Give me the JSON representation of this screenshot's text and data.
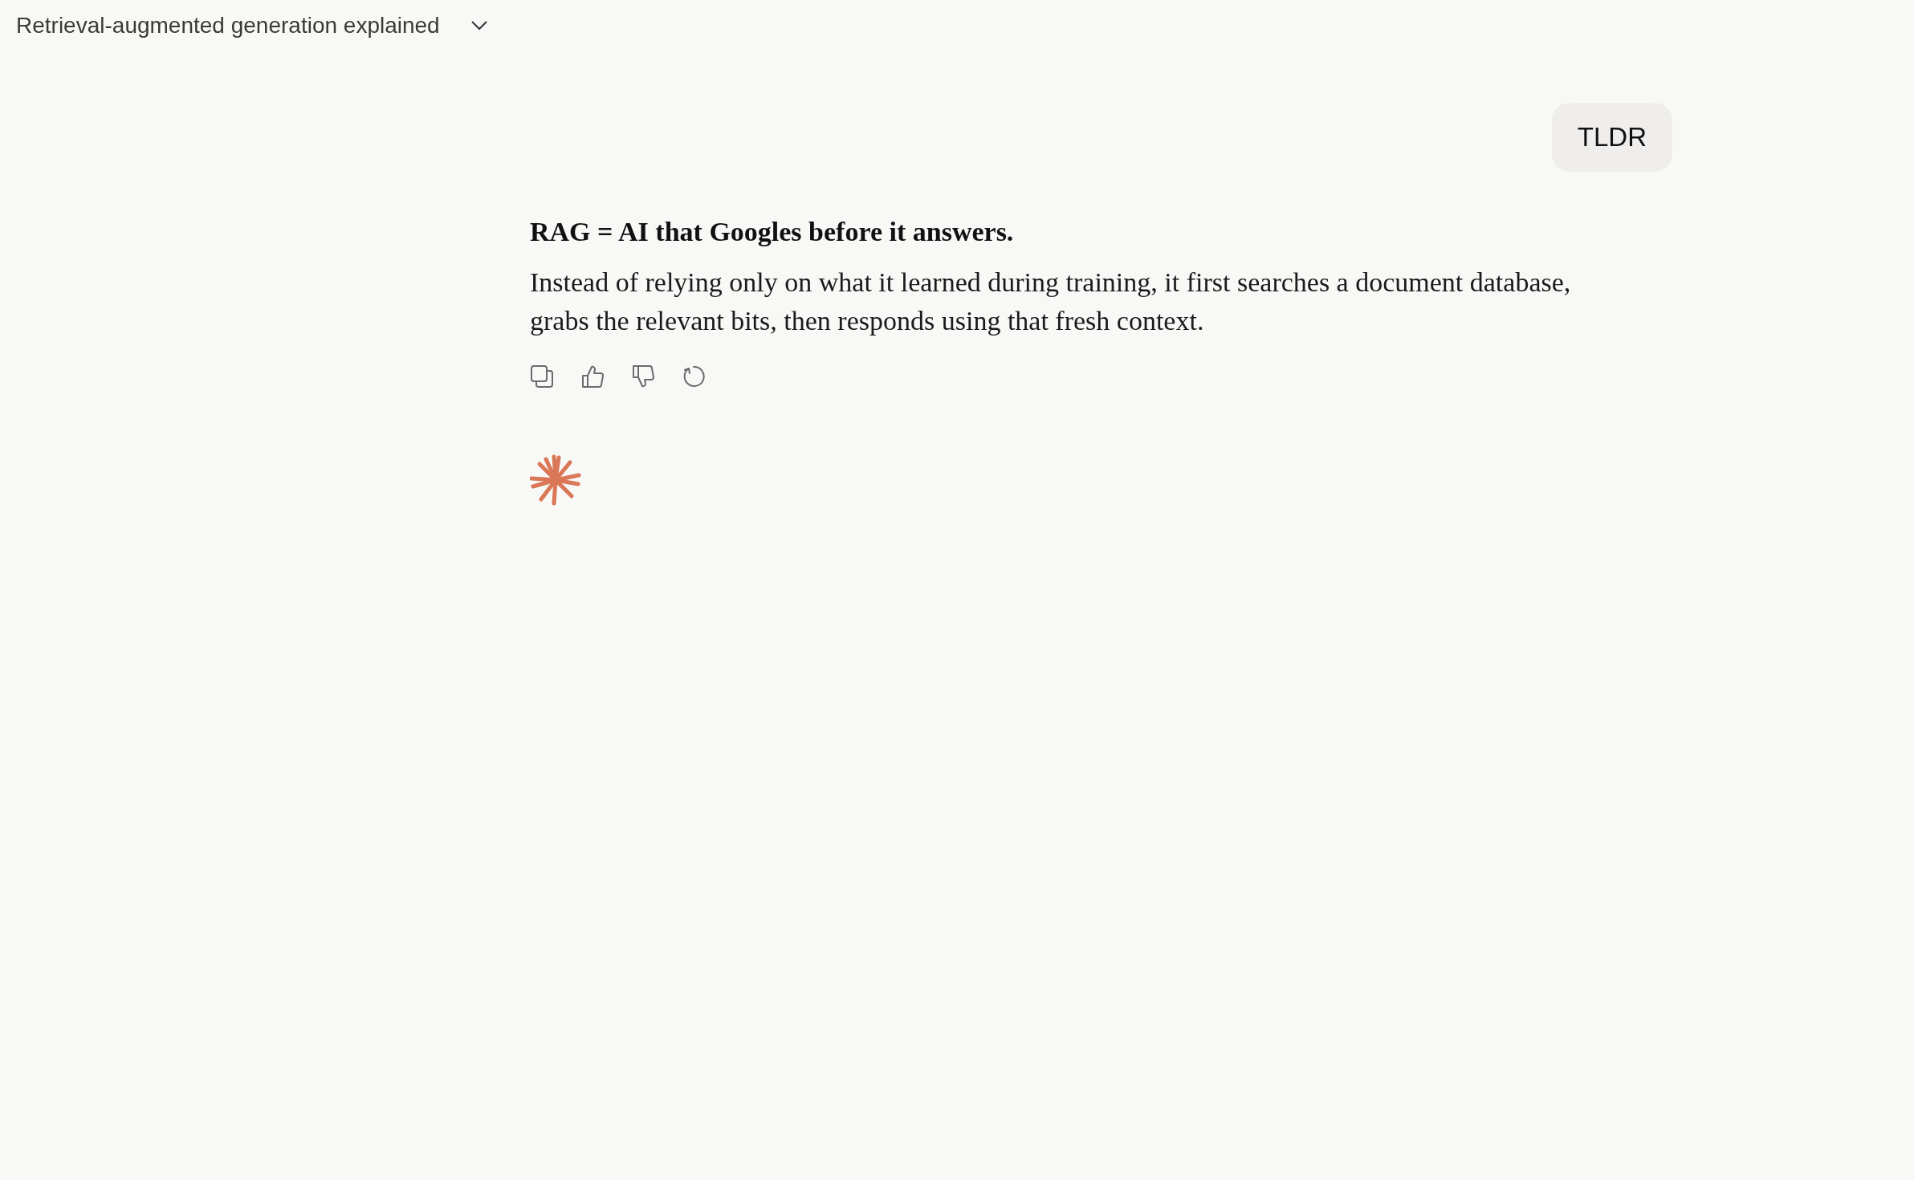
{
  "header": {
    "title": "Retrieval-augmented generation explained"
  },
  "user_message": {
    "text": "TLDR"
  },
  "response": {
    "heading": "RAG = AI that Googles before it answers.",
    "body": "Instead of relying only on what it learned during training, it first searches a document database, grabs the relevant bits, then responds using that fresh context.",
    "actions": [
      {
        "kind": "copy"
      },
      {
        "kind": "thumbs-up"
      },
      {
        "kind": "thumbs-down"
      },
      {
        "kind": "retry"
      }
    ]
  }
}
